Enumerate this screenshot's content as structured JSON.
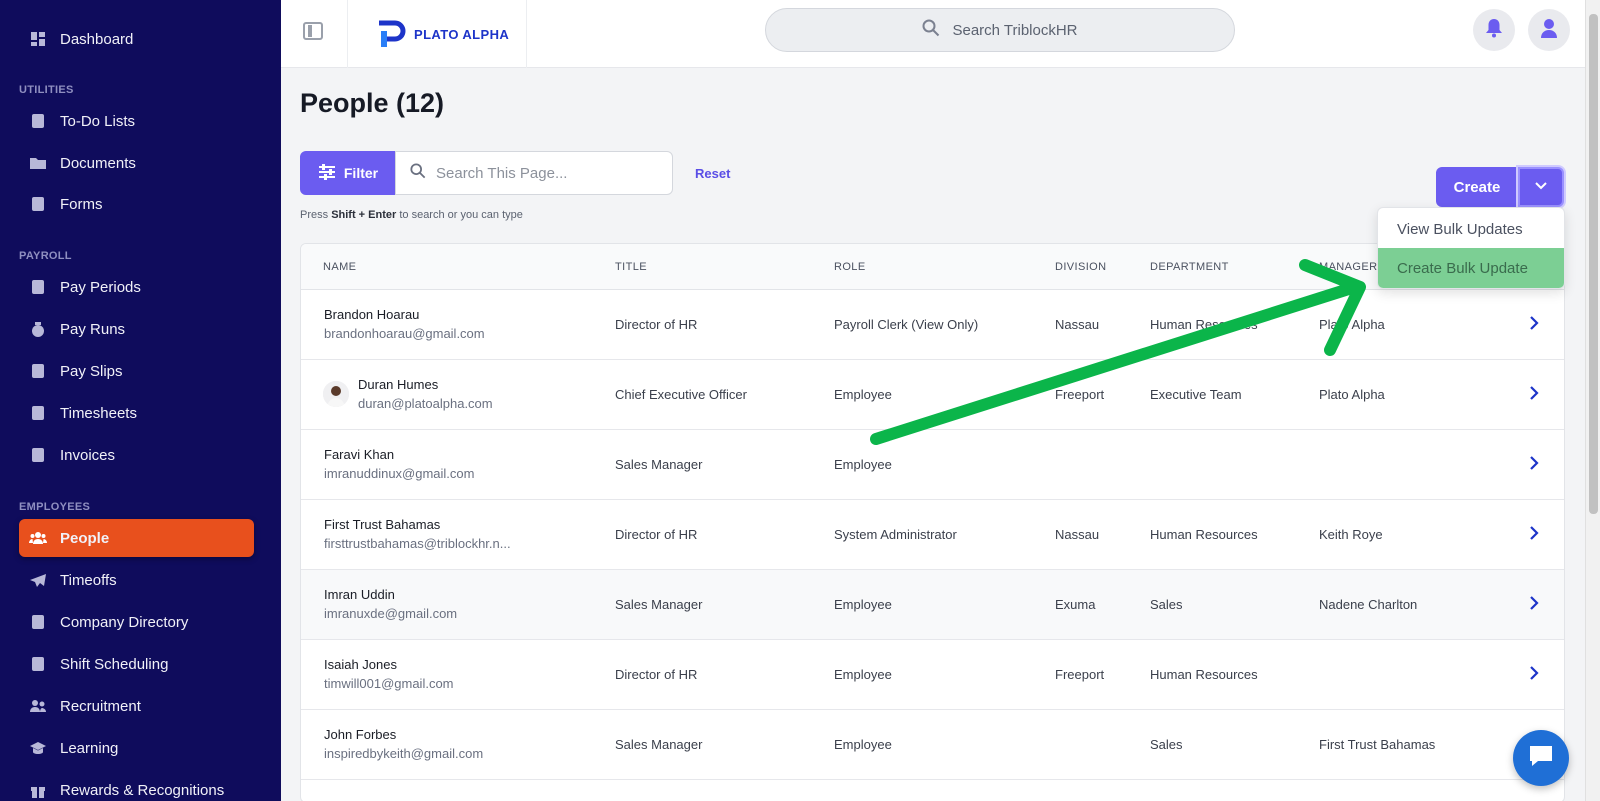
{
  "sidebar": {
    "items": [
      {
        "label": "Dashboard",
        "icon": "dashboard-icon"
      },
      {
        "label": "To-Do Lists",
        "icon": "clipboard-icon"
      },
      {
        "label": "Documents",
        "icon": "folder-icon"
      },
      {
        "label": "Forms",
        "icon": "form-check-icon"
      },
      {
        "label": "Pay Periods",
        "icon": "calendar-icon"
      },
      {
        "label": "Pay Runs",
        "icon": "money-bag-icon"
      },
      {
        "label": "Pay Slips",
        "icon": "receipt-icon"
      },
      {
        "label": "Timesheets",
        "icon": "clipboard-icon"
      },
      {
        "label": "Invoices",
        "icon": "invoice-icon"
      },
      {
        "label": "People",
        "icon": "people-icon"
      },
      {
        "label": "Timeoffs",
        "icon": "plane-icon"
      },
      {
        "label": "Company Directory",
        "icon": "contact-book-icon"
      },
      {
        "label": "Shift Scheduling",
        "icon": "calendar-icon"
      },
      {
        "label": "Recruitment",
        "icon": "users-icon"
      },
      {
        "label": "Learning",
        "icon": "graduation-icon"
      },
      {
        "label": "Rewards & Recognitions",
        "icon": "gift-icon"
      }
    ],
    "sections": {
      "utilities": "UTILITIES",
      "payroll": "PAYROLL",
      "employees": "EMPLOYEES"
    },
    "active": "People"
  },
  "topbar": {
    "logo_text": "PLATO ALPHA",
    "search_placeholder": "Search TriblockHR"
  },
  "main": {
    "title": "People (12)",
    "filter_label": "Filter",
    "search_placeholder": "Search This Page...",
    "reset_label": "Reset",
    "hint_prefix": "Press",
    "hint_keys": "Shift + Enter",
    "hint_suffix": "to search or you can type",
    "create_label": "Create"
  },
  "menu": {
    "items": [
      "View Bulk Updates",
      "Create Bulk Update"
    ],
    "highlighted": "Create Bulk Update"
  },
  "table": {
    "columns": [
      "NAME",
      "TITLE",
      "ROLE",
      "DIVISION",
      "DEPARTMENT",
      "MANAGER"
    ],
    "rows": [
      {
        "name": "Brandon Hoarau",
        "email": "brandonhoarau@gmail.com",
        "title": "Director of HR",
        "role": "Payroll Clerk (View Only)",
        "division": "Nassau",
        "department": "Human Resources",
        "manager": "Plato Alpha"
      },
      {
        "name": "Duran Humes",
        "email": "duran@platoalpha.com",
        "title": "Chief Executive Officer",
        "role": "Employee",
        "division": "Freeport",
        "department": "Executive Team",
        "manager": "Plato Alpha"
      },
      {
        "name": "Faravi Khan",
        "email": "imranuddinux@gmail.com",
        "title": "Sales Manager",
        "role": "Employee",
        "division": "",
        "department": "",
        "manager": ""
      },
      {
        "name": "First Trust Bahamas",
        "email": "firsttrustbahamas@triblockhr.n...",
        "title": "Director of HR",
        "role": "System Administrator",
        "division": "Nassau",
        "department": "Human Resources",
        "manager": "Keith Roye"
      },
      {
        "name": "Imran Uddin",
        "email": "imranuxde@gmail.com",
        "title": "Sales Manager",
        "role": "Employee",
        "division": "Exuma",
        "department": "Sales",
        "manager": "Nadene Charlton"
      },
      {
        "name": "Isaiah Jones",
        "email": "timwill001@gmail.com",
        "title": "Director of HR",
        "role": "Employee",
        "division": "Freeport",
        "department": "Human Resources",
        "manager": ""
      },
      {
        "name": "John Forbes",
        "email": "inspiredbykeith@gmail.com",
        "title": "Sales Manager",
        "role": "Employee",
        "division": "",
        "department": "Sales",
        "manager": "First Trust Bahamas"
      }
    ]
  },
  "colors": {
    "sidebar_bg": "#0f0c5c",
    "active": "#e8501d",
    "accent": "#6b5cf0",
    "highlight": "#7ccf94",
    "arrow": "#0bb54a"
  }
}
